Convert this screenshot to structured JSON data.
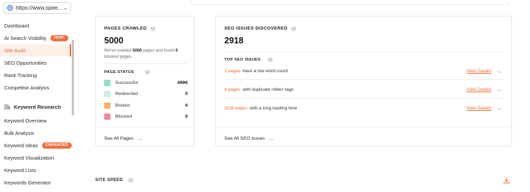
{
  "sidebar": {
    "domain": "https://www.spee...",
    "items": [
      {
        "label": "Dashboard",
        "badge": ""
      },
      {
        "label": "AI Search Visibility",
        "badge": "NEW!"
      },
      {
        "label": "Site Audit",
        "badge": ""
      },
      {
        "label": "SEO Opportunities",
        "badge": ""
      },
      {
        "label": "Rank Tracking",
        "badge": ""
      },
      {
        "label": "Competitor Analysis",
        "badge": ""
      }
    ],
    "keyword_section": "Keyword Research",
    "keyword_items": [
      {
        "label": "Keyword Overview",
        "badge": ""
      },
      {
        "label": "Bulk Analysis",
        "badge": ""
      },
      {
        "label": "Keyword Ideas",
        "badge": "ENHANCED"
      },
      {
        "label": "Keyword Visualization",
        "badge": ""
      },
      {
        "label": "Keyword Lists",
        "badge": ""
      },
      {
        "label": "Keywords Generator",
        "badge": ""
      }
    ],
    "active_item": "Site Audit",
    "accent_color": "#ef6a2a",
    "badge_color": "#f26d3b"
  },
  "pages_crawled": {
    "title": "PAGES CRAWLED",
    "value": "5000",
    "desc_pre": "We've crawled ",
    "desc_pages": "5000",
    "desc_mid": " pages and found ",
    "desc_blocked": "0",
    "desc_post": " blocked pages.",
    "status_title": "PAGE STATUS",
    "statuses": [
      {
        "label": "Successful",
        "value": "4996",
        "color": "#8fe0bd"
      },
      {
        "label": "Redirected",
        "value": "0",
        "color": "#c8efdf"
      },
      {
        "label": "Broken",
        "value": "4",
        "color": "#f5b25c"
      },
      {
        "label": "Blocked",
        "value": "0",
        "color": "#f38896"
      }
    ],
    "footer": "See All Pages"
  },
  "seo_issues": {
    "title": "SEO ISSUES DISCOVERED",
    "value": "2918",
    "top_title": "TOP SEO ISSUES",
    "issues": [
      {
        "count": "1 pages",
        "text": "have a low word count",
        "link": "View Details"
      },
      {
        "count": "4 pages",
        "text": "with duplicate <title> tags",
        "link": "View Details"
      },
      {
        "count": "1118 pages",
        "text": "with a long loading time",
        "link": "View Details"
      }
    ],
    "footer": "See All SEO Issues"
  },
  "site_speed": {
    "title": "SITE SPEED"
  },
  "icons": {
    "domain": "globe-icon",
    "dropdown": "chevron-down-icon",
    "info": "info-icon",
    "arrow": "arrow-right-icon",
    "download": "download-icon",
    "keyword": "keyword-research-icon"
  }
}
